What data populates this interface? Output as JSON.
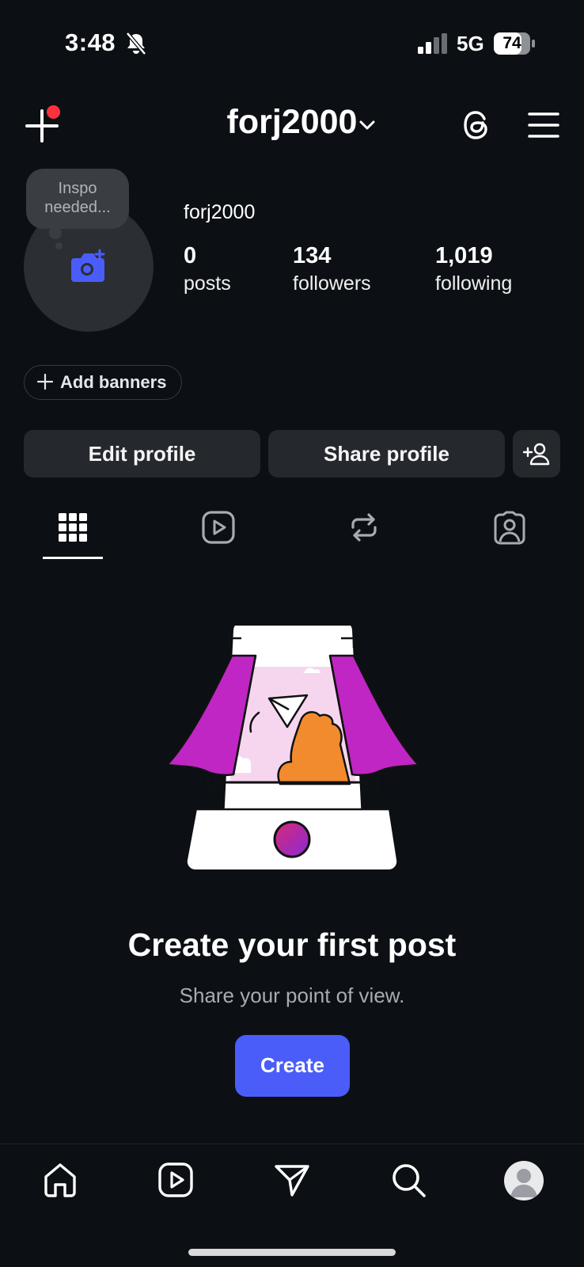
{
  "status_bar": {
    "time": "3:48",
    "network": "5G",
    "battery": "74"
  },
  "header": {
    "username": "forj2000",
    "icons": [
      "new-post-icon",
      "chevron-down-icon",
      "threads-icon",
      "menu-icon"
    ]
  },
  "profile": {
    "name": "forj2000",
    "note_bubble": "Inspo needed...",
    "stats": [
      {
        "value": "0",
        "label": "posts"
      },
      {
        "value": "134",
        "label": "followers"
      },
      {
        "value": "1,019",
        "label": "following"
      }
    ],
    "add_banners": "Add banners",
    "edit_profile": "Edit profile",
    "share_profile": "Share profile"
  },
  "tabs": {
    "active": "grid",
    "items": [
      "grid-icon",
      "reels-icon",
      "reposts-icon",
      "tagged-icon"
    ]
  },
  "empty_state": {
    "title": "Create your first post",
    "subtitle": "Share your point of view.",
    "button": "Create"
  },
  "bottom_nav": [
    "home-icon",
    "reels-icon",
    "messages-icon",
    "search-icon",
    "profile-avatar"
  ],
  "colors": {
    "background": "#0c1014",
    "accent": "#4a5df9",
    "notification": "#ff3040",
    "card": "#25292e"
  }
}
